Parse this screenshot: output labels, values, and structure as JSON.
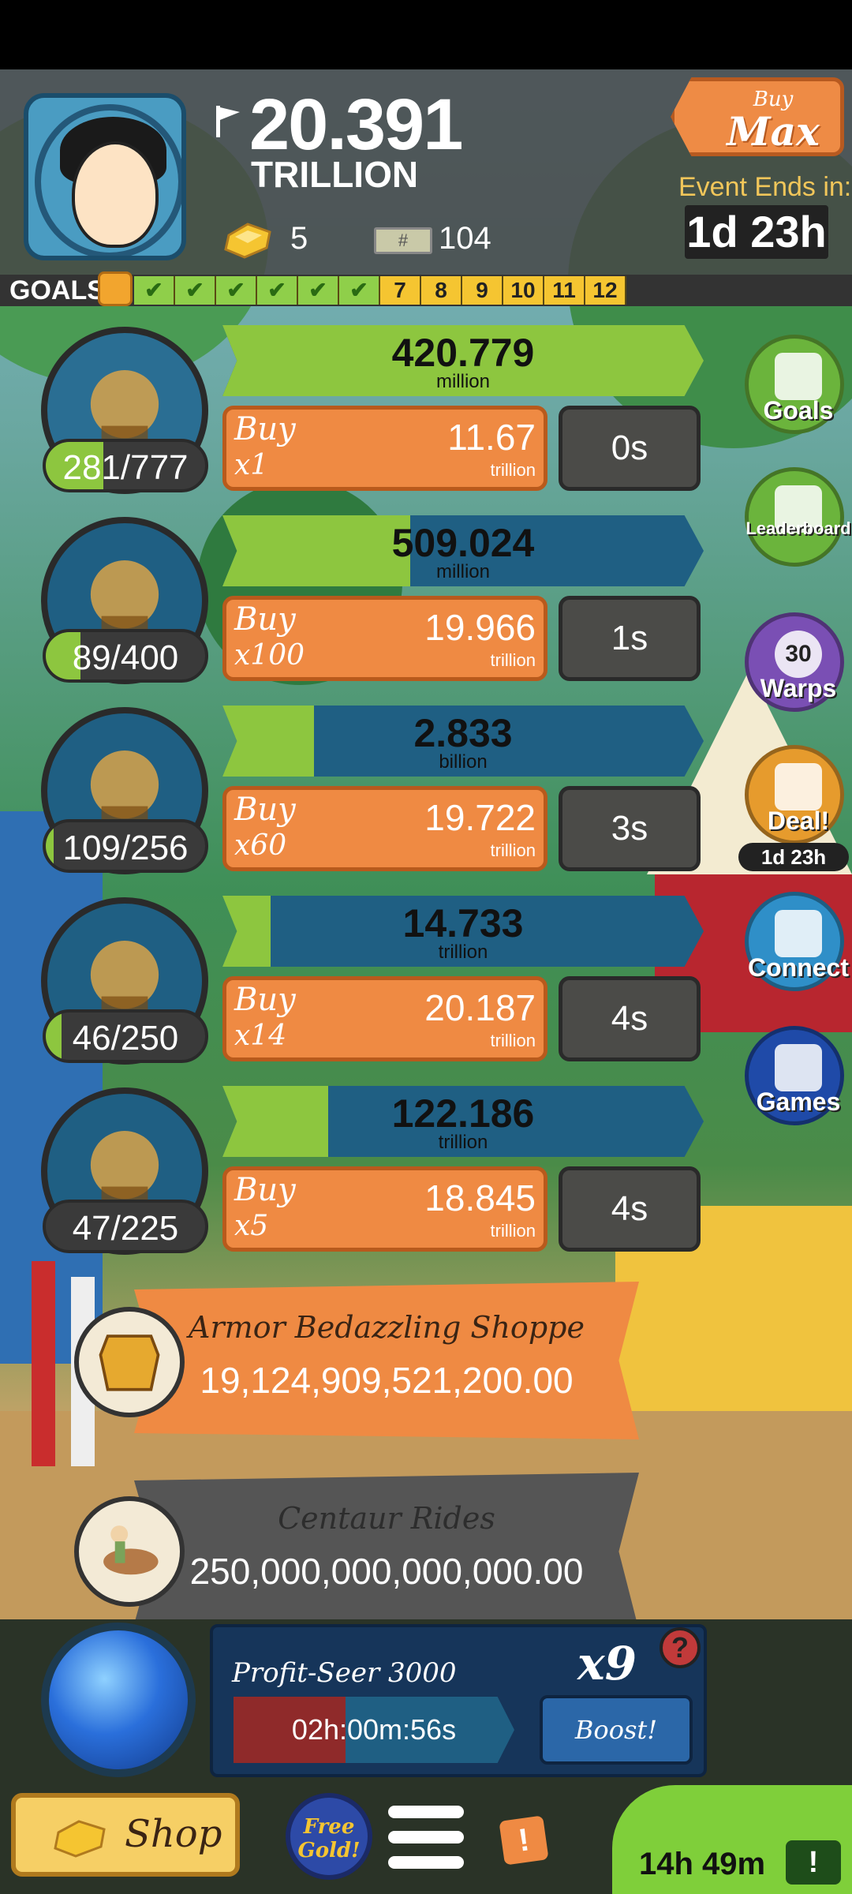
{
  "header": {
    "money_value": "20.391",
    "money_unit": "TRILLION",
    "gold_count": "5",
    "mega_count": "104",
    "mega_symbol": "#",
    "buy_max_small": "Buy",
    "buy_max_big": "Max",
    "event_label": "Event Ends in:",
    "event_timer": "1d 23h"
  },
  "goals": {
    "label": "GOALS",
    "completed": 6,
    "pending": [
      "7",
      "8",
      "9",
      "10",
      "11",
      "12"
    ]
  },
  "businesses": [
    {
      "owned": "281/777",
      "owned_fraction": 0.36,
      "income": "420.779",
      "income_unit": "million",
      "progress": 1.0,
      "buy_label": "Buy",
      "buy_qty": "x1",
      "cost": "11.67",
      "cost_unit": "trillion",
      "time": "0s",
      "icon": "hat-dog-icon"
    },
    {
      "owned": "89/400",
      "owned_fraction": 0.22,
      "income": "509.024",
      "income_unit": "million",
      "progress": 0.39,
      "buy_label": "Buy",
      "buy_qty": "x100",
      "cost": "19.966",
      "cost_unit": "trillion",
      "time": "1s",
      "icon": "painting-icon"
    },
    {
      "owned": "109/256",
      "owned_fraction": 0.05,
      "income": "2.833",
      "income_unit": "billion",
      "progress": 0.19,
      "buy_label": "Buy",
      "buy_qty": "x60",
      "cost": "19.722",
      "cost_unit": "trillion",
      "time": "3s",
      "icon": "chariot-icon"
    },
    {
      "owned": "46/250",
      "owned_fraction": 0.1,
      "income": "14.733",
      "income_unit": "trillion",
      "progress": 0.1,
      "buy_label": "Buy",
      "buy_qty": "x14",
      "cost": "20.187",
      "cost_unit": "trillion",
      "time": "4s",
      "icon": "dragon-icon"
    },
    {
      "owned": "47/225",
      "owned_fraction": 0.0,
      "income": "122.186",
      "income_unit": "trillion",
      "progress": 0.22,
      "buy_label": "Buy",
      "buy_qty": "x5",
      "cost": "18.845",
      "cost_unit": "trillion",
      "time": "4s",
      "icon": "horse-race-icon"
    }
  ],
  "side_buttons": [
    {
      "label": "Goals",
      "color": "#6bb43c",
      "icon": "checklist-icon"
    },
    {
      "label": "Leaderboard",
      "color": "#6bb43c",
      "icon": "trophy-icon"
    },
    {
      "label": "Warps",
      "color": "#7a4fb4",
      "icon": "warp-icon",
      "badge": "30"
    },
    {
      "label": "Deal!",
      "color": "#e69b2d",
      "icon": "gift-icon",
      "sub": "1d 23h"
    },
    {
      "label": "Connect",
      "color": "#2f8fc8",
      "icon": "cards-icon"
    },
    {
      "label": "Games",
      "color": "#1f4aa8",
      "icon": "games-icon"
    }
  ],
  "shops": [
    {
      "name": "Armor Bedazzling Shoppe",
      "value": "19,124,909,521,200.00",
      "icon": "armor-icon"
    },
    {
      "name": "Centaur Rides",
      "value": "250,000,000,000,000.00",
      "icon": "centaur-icon"
    }
  ],
  "profit_seer": {
    "name": "Profit-Seer 3000",
    "multiplier": "x9",
    "help": "?",
    "timer": "02h:00m:56s",
    "fill_fraction": 0.4,
    "boost_label": "Boost!"
  },
  "bottom": {
    "shop_label": "Shop",
    "free_gold_line1": "Free",
    "free_gold_line2": "Gold!",
    "alert": "!",
    "timer": "14h 49m",
    "tv_icon": "!"
  },
  "colors": {
    "green": "#8dc63f",
    "blue": "#1f5f83",
    "orange": "#ef8a43",
    "gray": "#4b4b48"
  }
}
